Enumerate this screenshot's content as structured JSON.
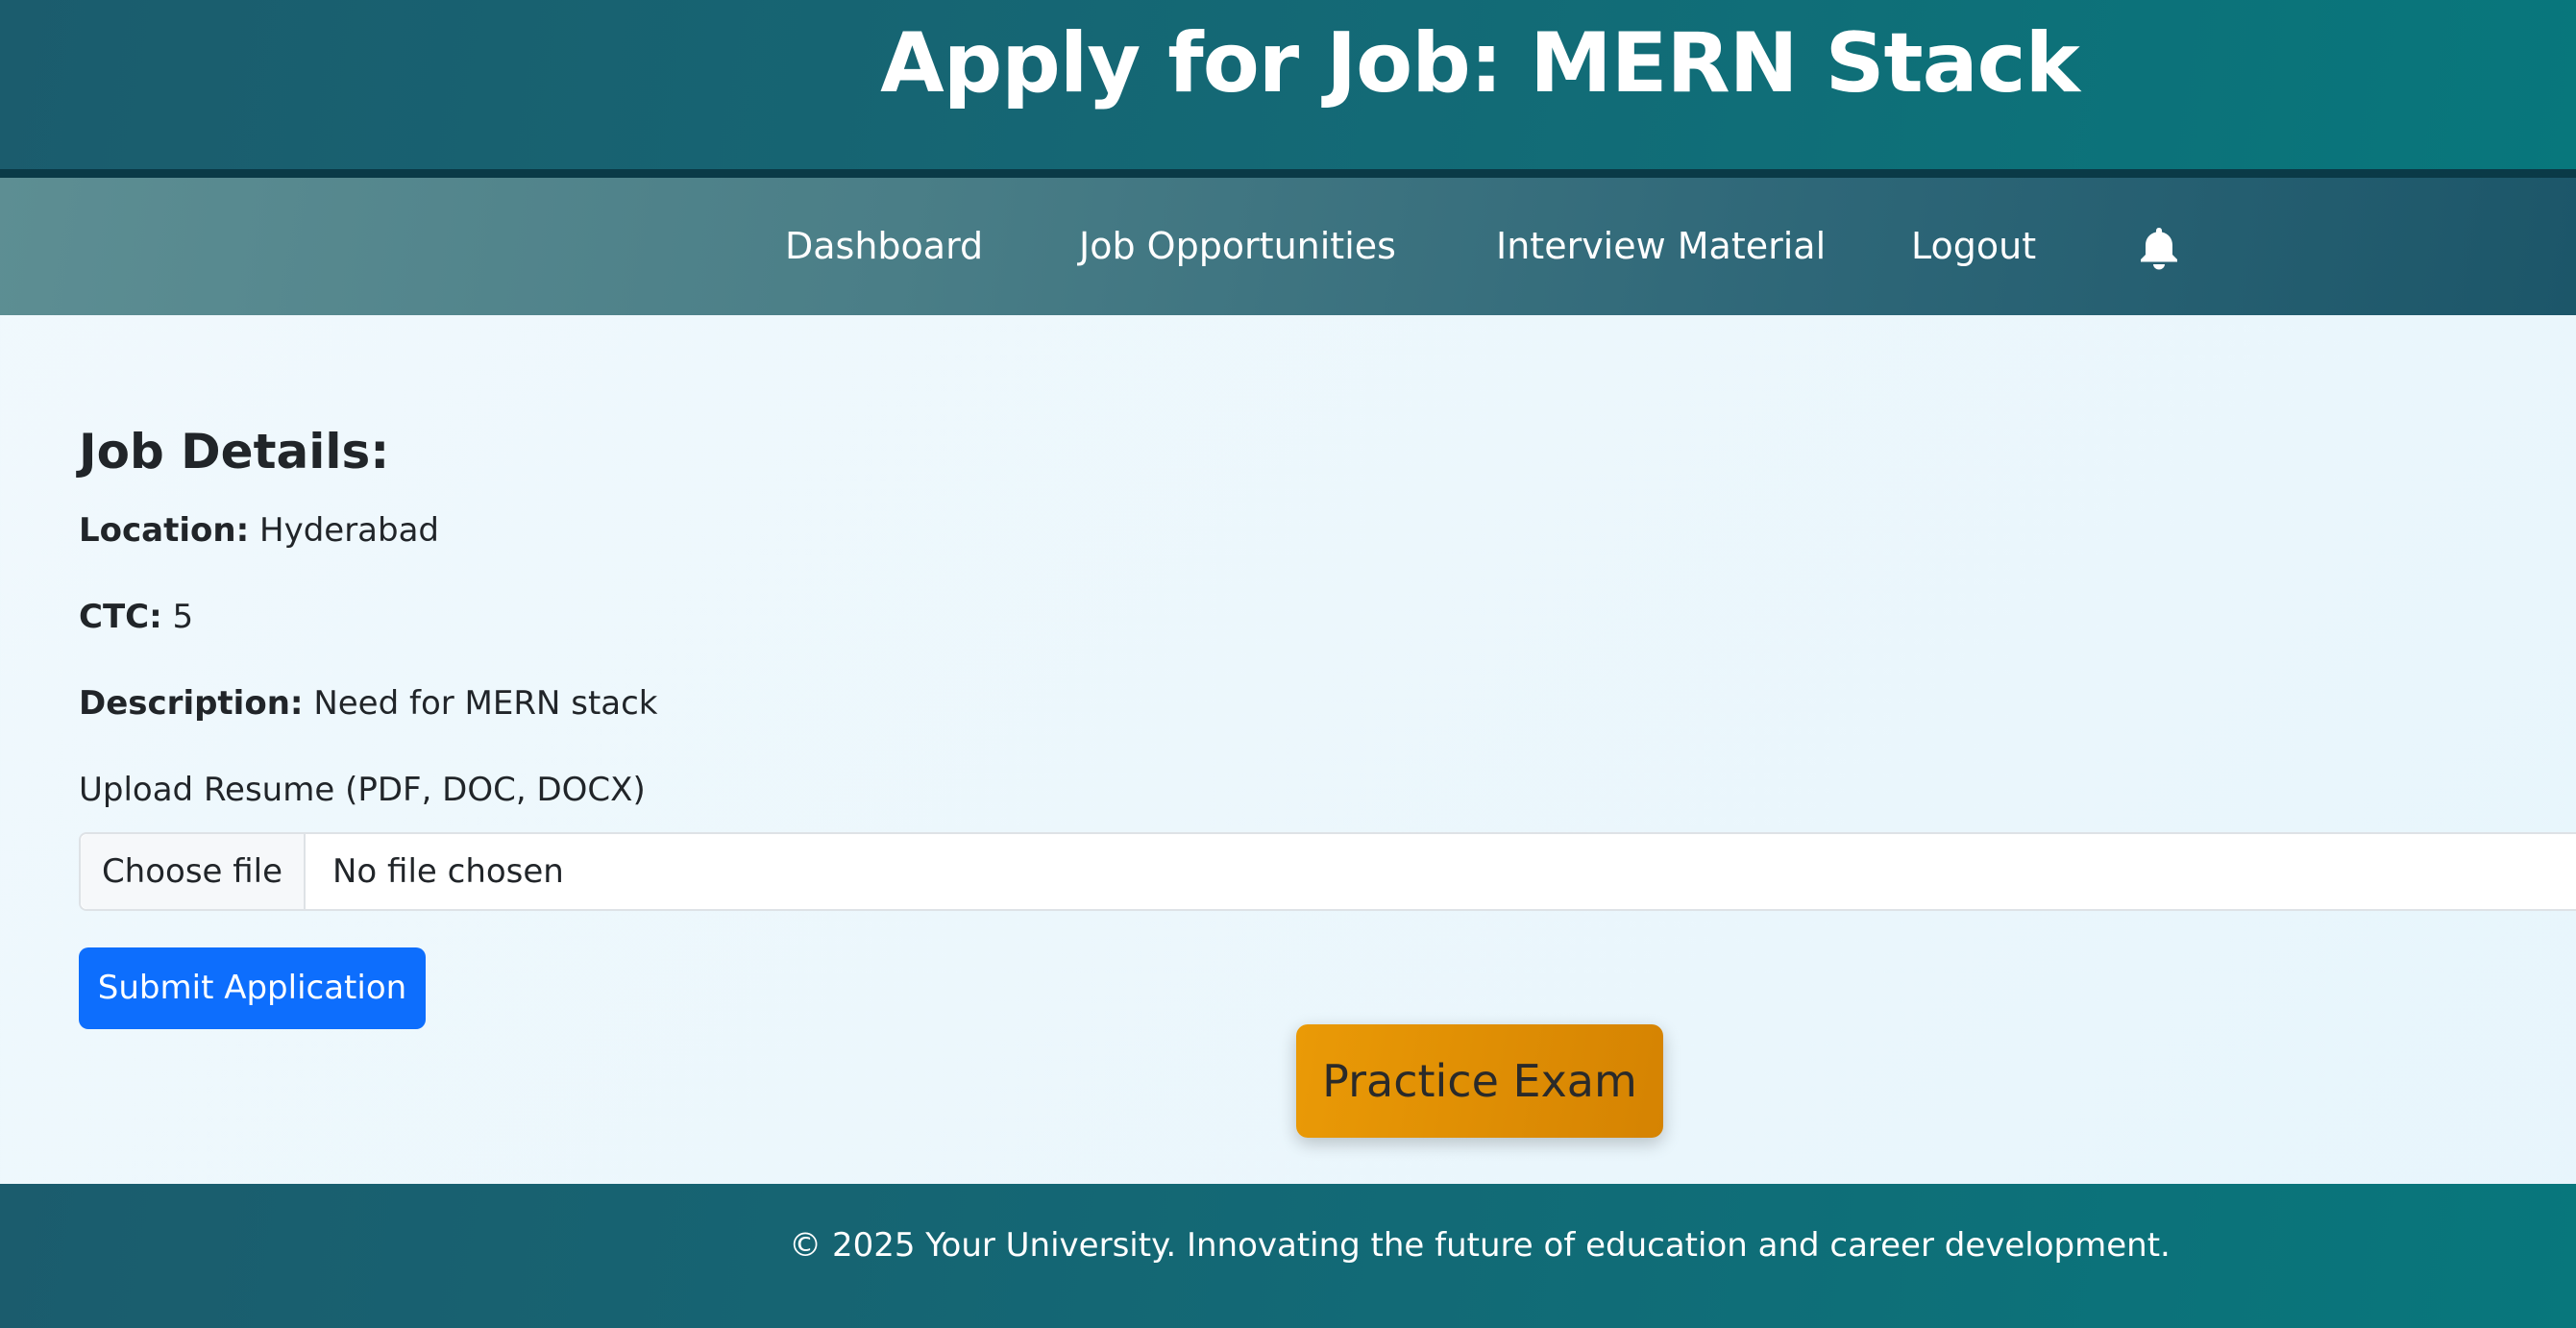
{
  "header": {
    "title": "Apply for Job: MERN Stack"
  },
  "nav": {
    "items": [
      {
        "label": "Dashboard"
      },
      {
        "label": "Job Opportunities"
      },
      {
        "label": "Interview Material"
      },
      {
        "label": "Logout"
      }
    ],
    "bell_icon": "bell-icon"
  },
  "job": {
    "heading": "Job Details:",
    "location_label": "Location:",
    "location_value": "Hyderabad",
    "ctc_label": "CTC:",
    "ctc_value": "5",
    "description_label": "Description:",
    "description_value": "Need for MERN stack"
  },
  "upload": {
    "label": "Upload Resume (PDF, DOC, DOCX)",
    "button_label": "Choose file",
    "status": "No file chosen"
  },
  "actions": {
    "submit_label": "Submit Application",
    "practice_label": "Practice Exam"
  },
  "footer": {
    "text": "© 2025 Your University. Innovating the future of education and career development."
  },
  "colors": {
    "header_bg": "#136a76",
    "nav_bg": "#4a7e87",
    "submit_bg": "#0d6efd",
    "practice_bg": "#e09005",
    "page_bg": "#eaf6fc"
  }
}
